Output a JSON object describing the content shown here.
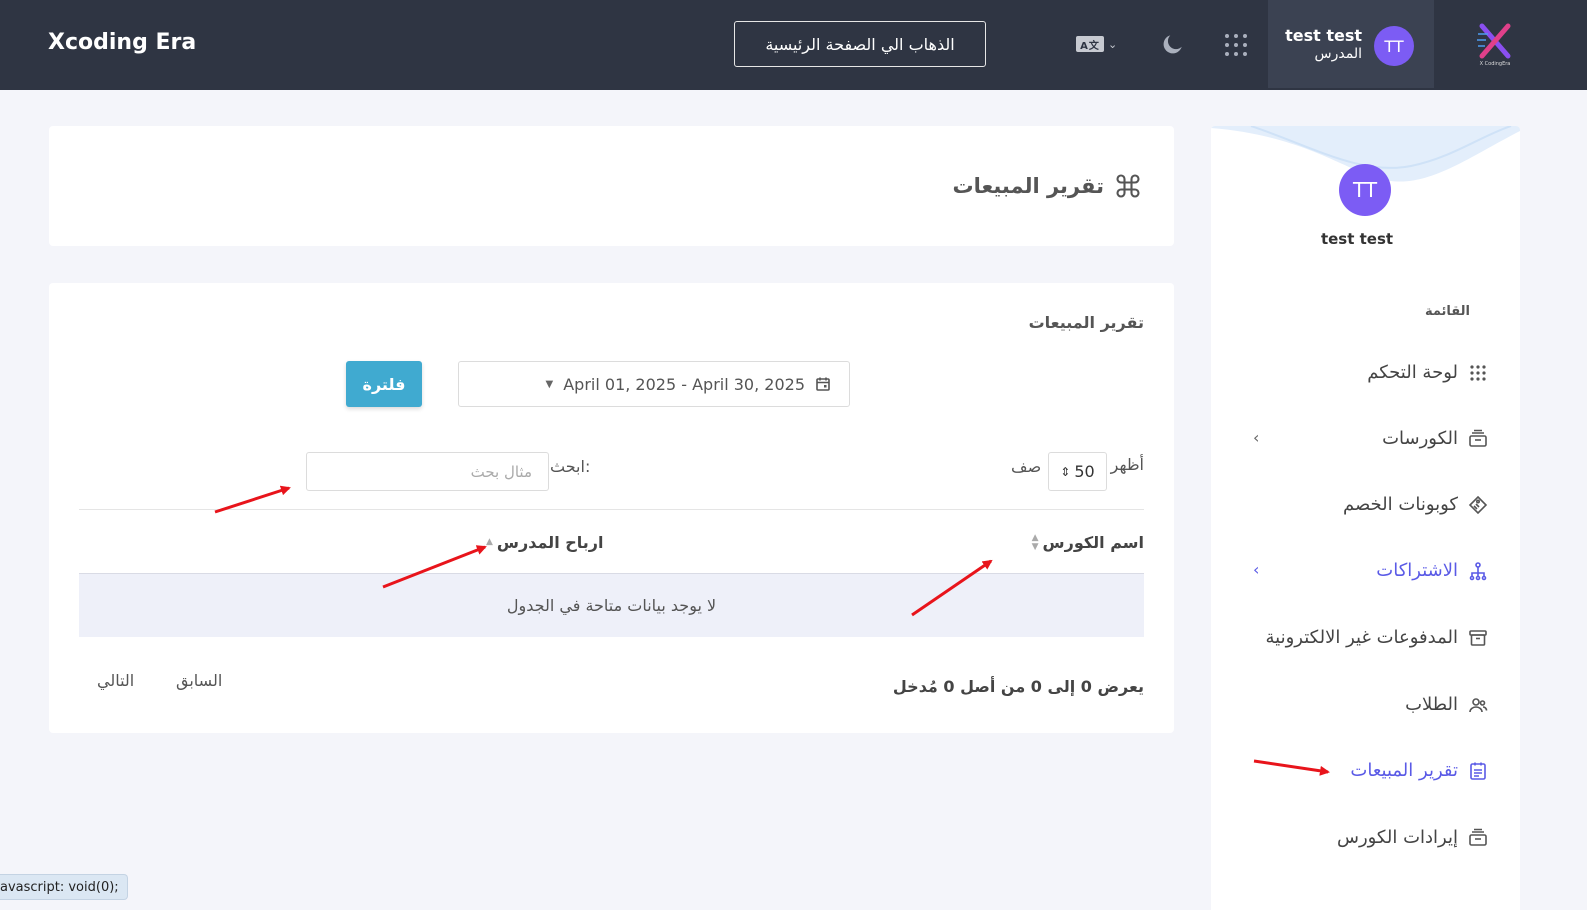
{
  "header": {
    "brand": "Xcoding Era",
    "home_button": "الذهاب الي الصفحة الرئيسية",
    "user_name": "test test",
    "user_role": "المدرس",
    "avatar_initials": "TT",
    "logo_caption": "X CodingEra"
  },
  "sidebar": {
    "avatar_initials": "TT",
    "user_name": "test test",
    "menu_title": "القائمة",
    "items": [
      {
        "label": "لوحة التحكم",
        "icon": "grid-icon"
      },
      {
        "label": "الكورسات",
        "icon": "courses-icon"
      },
      {
        "label": "كوبونات الخصم",
        "icon": "tag-icon"
      },
      {
        "label": "الاشتراكات",
        "icon": "subscriptions-icon"
      },
      {
        "label": "المدفوعات غير الالكترونية",
        "icon": "archive-icon"
      },
      {
        "label": "الطلاب",
        "icon": "users-icon"
      },
      {
        "label": "تقرير المبيعات",
        "icon": "report-icon"
      },
      {
        "label": "إيرادات الكورس",
        "icon": "revenue-icon"
      }
    ]
  },
  "page": {
    "title": "تقرير المبيعات"
  },
  "report": {
    "section_title": "تقرير المبيعات",
    "date_range": "April 01, 2025 - April 30, 2025",
    "filter_button": "فلترة",
    "show_label": "أظهر",
    "page_length": "50",
    "rows_label": "صف",
    "search_label": "ابحث:",
    "search_placeholder": "مثال بحث",
    "columns": [
      "اسم الكورس",
      "ارباح المدرس"
    ],
    "empty_message": "لا يوجد بيانات متاحة في الجدول",
    "info": "يعرض 0 إلى 0 من أصل 0 مُدخل",
    "prev": "السابق",
    "next": "التالي"
  },
  "status_bar": "avascript: void(0);",
  "colors": {
    "topbar": "#2f3543",
    "accent": "#5a5ae6",
    "filter_button": "#40aad0",
    "avatar": "#7c5cf4",
    "annotation_arrow": "#e8141b"
  }
}
